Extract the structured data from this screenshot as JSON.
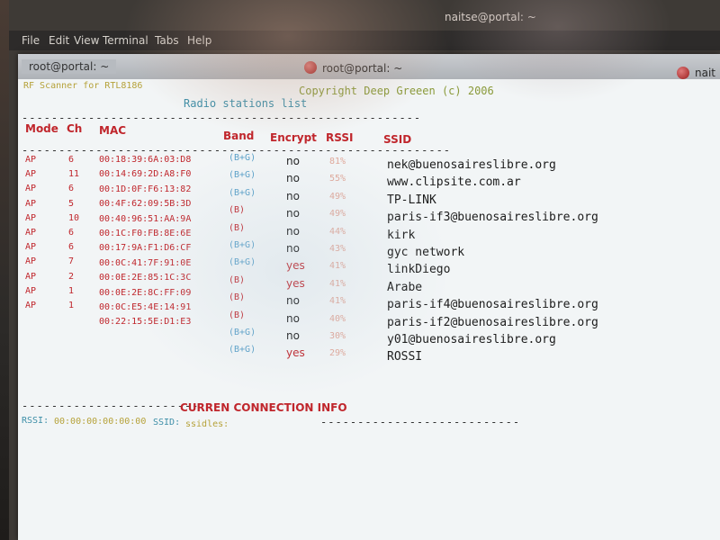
{
  "back_window": {
    "title": "naitse@portal: ~",
    "menu": [
      "File",
      "Edit",
      "View",
      "Terminal",
      "Tabs",
      "Help"
    ]
  },
  "front_window": {
    "tab_title": "root@portal: ~",
    "title": "root@portal: ~",
    "right_tab_fragment": "nait"
  },
  "terminal": {
    "program_name": "RF Scanner for RTL8186",
    "copyright": "Copyright Deep Greeen (c) 2006",
    "subtitle": "Radio stations list",
    "headers": {
      "mode": "Mode",
      "ch": "Ch",
      "mac": "MAC",
      "band": "Band",
      "encrypt": "Encrypt",
      "rssi": "RSSI",
      "ssid": "SSID"
    },
    "stations": [
      {
        "mode": "AP",
        "ch": "6",
        "mac": "00:18:39:6A:03:D8",
        "band": "(B+G)",
        "encrypt": "no",
        "rssi": "81%",
        "ssid": "nek@buenosaireslibre.org"
      },
      {
        "mode": "AP",
        "ch": "11",
        "mac": "00:14:69:2D:A8:F0",
        "band": "(B+G)",
        "encrypt": "no",
        "rssi": "55%",
        "ssid": "www.clipsite.com.ar"
      },
      {
        "mode": "AP",
        "ch": "6",
        "mac": "00:1D:0F:F6:13:82",
        "band": "(B+G)",
        "encrypt": "no",
        "rssi": "49%",
        "ssid": "TP-LINK"
      },
      {
        "mode": "AP",
        "ch": "5",
        "mac": "00:4F:62:09:5B:3D",
        "band": "(B)",
        "encrypt": "no",
        "rssi": "49%",
        "ssid": "paris-if3@buenosaireslibre.org"
      },
      {
        "mode": "AP",
        "ch": "10",
        "mac": "00:40:96:51:AA:9A",
        "band": "(B)",
        "encrypt": "no",
        "rssi": "44%",
        "ssid": "kirk"
      },
      {
        "mode": "AP",
        "ch": "6",
        "mac": "00:1C:F0:FB:8E:6E",
        "band": "(B+G)",
        "encrypt": "no",
        "rssi": "43%",
        "ssid": "gyc network"
      },
      {
        "mode": "AP",
        "ch": "6",
        "mac": "00:17:9A:F1:D6:CF",
        "band": "(B+G)",
        "encrypt": "yes",
        "rssi": "41%",
        "ssid": "linkDiego"
      },
      {
        "mode": "AP",
        "ch": "7",
        "mac": "00:0C:41:7F:91:0E",
        "band": "(B)",
        "encrypt": "yes",
        "rssi": "41%",
        "ssid": "Arabe"
      },
      {
        "mode": "AP",
        "ch": "2",
        "mac": "00:0E:2E:85:1C:3C",
        "band": "(B)",
        "encrypt": "no",
        "rssi": "41%",
        "ssid": "paris-if4@buenosaireslibre.org"
      },
      {
        "mode": "AP",
        "ch": "1",
        "mac": "00:0E:2E:8C:FF:09",
        "band": "(B)",
        "encrypt": "no",
        "rssi": "40%",
        "ssid": "paris-if2@buenosaireslibre.org"
      },
      {
        "mode": "AP",
        "ch": "1",
        "mac": "00:0C:E5:4E:14:91",
        "band": "(B+G)",
        "encrypt": "no",
        "rssi": "30%",
        "ssid": "y01@buenosaireslibre.org"
      },
      {
        "mode": "",
        "ch": "",
        "mac": "00:22:15:5E:D1:E3",
        "band": "(B+G)",
        "encrypt": "yes",
        "rssi": "29%",
        "ssid": "ROSSI"
      }
    ],
    "connection_header": "CURREN CONNECTION INFO",
    "rssi_label": "RSSI:",
    "rssi_value": "00:00:00:00:00:00",
    "ssid_label": "SSID:",
    "ssid_value": "ssidles:"
  },
  "colors": {
    "terminal_bg": "#f2f5f6",
    "header_red": "#c0262c",
    "band_blue": "#5aa0c8",
    "rssi_orange": "#e0a89a",
    "program_yellow": "#b6a23a"
  }
}
